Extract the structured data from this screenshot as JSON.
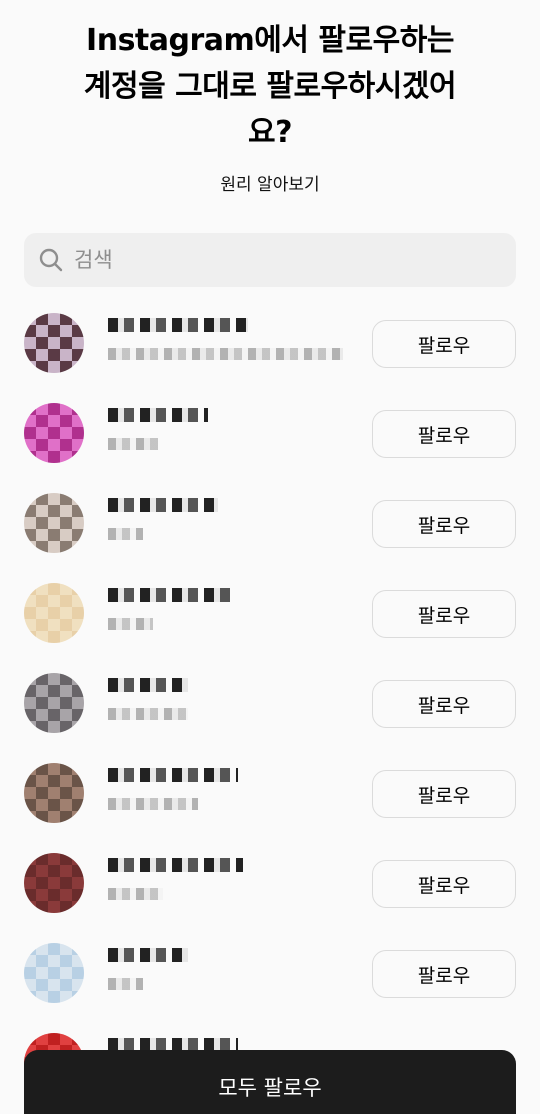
{
  "header": {
    "title": "Instagram에서 팔로우하는 계정을 그대로 팔로우하시겠어요?",
    "learn_more": "원리 알아보기"
  },
  "search": {
    "placeholder": "검색",
    "icon": "search-icon"
  },
  "accounts": [
    {
      "follow_label": "팔로우",
      "avatar_colors": [
        "#c9b4c8",
        "#3a2a30",
        "#e8d8e0",
        "#5a3a45",
        "#b08f9e",
        "#2a1f28"
      ]
    },
    {
      "follow_label": "팔로우",
      "avatar_colors": [
        "#b0308e",
        "#d94fb0",
        "#8a1e6a",
        "#e070c8",
        "#a02a80",
        "#6a1450"
      ]
    },
    {
      "follow_label": "팔로우",
      "avatar_colors": [
        "#d8ccc4",
        "#b4a498",
        "#eee4de",
        "#8a7c72",
        "#c6b8ae",
        "#f4eeea"
      ]
    },
    {
      "follow_label": "팔로우",
      "avatar_colors": [
        "#e8d0a8",
        "#6a5028",
        "#c8a858",
        "#f0e0c0",
        "#3a2a18",
        "#b09048"
      ]
    },
    {
      "follow_label": "팔로우",
      "avatar_colors": [
        "#a8a4a8",
        "#4a464a",
        "#d8d4d8",
        "#686468",
        "#bcb8bc",
        "#2c282c"
      ]
    },
    {
      "follow_label": "팔로우",
      "avatar_colors": [
        "#a08070",
        "#2a2420",
        "#d8ccc0",
        "#6a5448",
        "#c4b4a4",
        "#402c24"
      ]
    },
    {
      "follow_label": "팔로우",
      "avatar_colors": [
        "#8a3a3a",
        "#4a1e1e",
        "#c06060",
        "#6a2c2c",
        "#a84848",
        "#2a1010"
      ]
    },
    {
      "follow_label": "팔로우",
      "avatar_colors": [
        "#b8d0e4",
        "#e08890",
        "#8aa8c4",
        "#d8e4ee",
        "#c06070",
        "#a0bcd4"
      ]
    },
    {
      "follow_label": "",
      "avatar_colors": [
        "#c02020",
        "#f0e0e0",
        "#801010",
        "#e04040",
        "#f8f0f0",
        "#a01818"
      ]
    }
  ],
  "footer": {
    "follow_all_label": "모두 팔로우"
  },
  "colors": {
    "background": "#fafafa",
    "search_bg": "#efefef",
    "button_border": "#dbdbdb",
    "follow_all_bg": "#1c1c1c",
    "follow_all_text": "#ffffff"
  }
}
